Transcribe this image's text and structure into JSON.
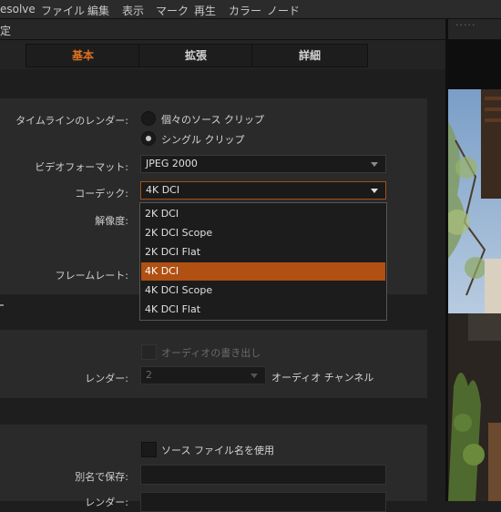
{
  "menubar": {
    "app": "esolve",
    "items": [
      "ファイル",
      "編集",
      "表示",
      "マーク",
      "再生",
      "カラー",
      "ノード"
    ]
  },
  "window": {
    "title": "定"
  },
  "right_panel": {
    "dots": "·····"
  },
  "tabs": [
    {
      "label": "基本",
      "active": true
    },
    {
      "label": "拡張",
      "active": false
    },
    {
      "label": "詳細",
      "active": false
    }
  ],
  "render": {
    "timeline_render_label": "タイムラインのレンダー:",
    "options": [
      {
        "label": "個々のソース クリップ",
        "selected": false
      },
      {
        "label": "シングル クリップ",
        "selected": true
      }
    ],
    "video_format_label": "ビデオフォーマット:",
    "video_format_value": "JPEG 2000",
    "codec_label": "コーデック:",
    "codec_value": "4K DCI",
    "resolution_label": "解像度:",
    "framerate_label": "フレームレート:",
    "codec_options": [
      "2K DCI",
      "2K DCI Scope",
      "2K DCI Flat",
      "4K DCI",
      "4K DCI Scope",
      "4K DCI Flat"
    ],
    "codec_highlighted": "4K DCI"
  },
  "audio": {
    "export_label": "オーディオの書き出し",
    "render_label": "レンダー:",
    "render_value": "2",
    "channels_label": "オーディオ チャンネル"
  },
  "file": {
    "use_source_name_label": "ソース ファイル名を使用",
    "save_as_label": "別名で保存:",
    "render_label": "レンダー:"
  },
  "colors": {
    "accent": "#e07020",
    "highlight": "#b05012"
  }
}
